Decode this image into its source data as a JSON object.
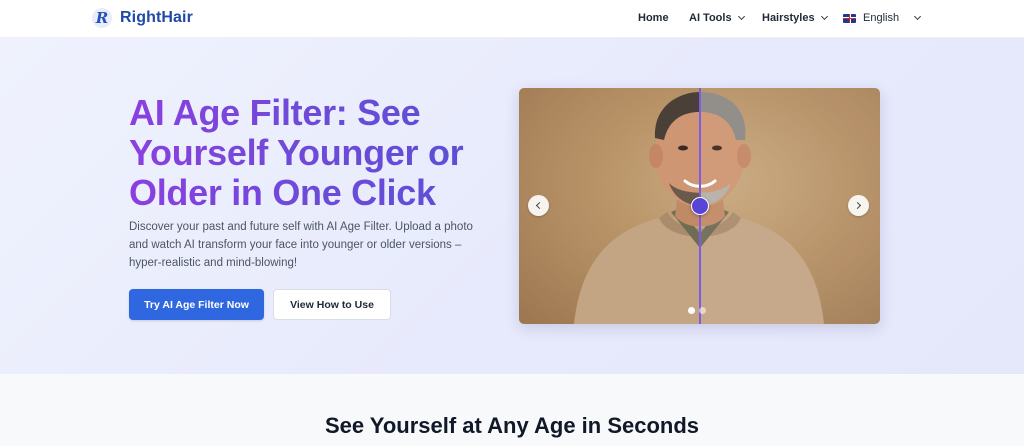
{
  "nav": {
    "brand_letter": "R",
    "brand_name": "RightHair",
    "links": [
      {
        "label": "Home",
        "has_dropdown": false
      },
      {
        "label": "AI Tools",
        "has_dropdown": true
      },
      {
        "label": "Hairstyles",
        "has_dropdown": true
      }
    ],
    "language": {
      "label": "English",
      "icon": "uk-flag-icon"
    }
  },
  "hero": {
    "title": "AI Age Filter: See Yourself Younger or Older in One Click",
    "description": "Discover your past and future self with AI Age Filter. Upload a photo and watch AI transform your face into younger or older versions – hyper-realistic and mind-blowing!",
    "primary_button": "Try AI Age Filter Now",
    "secondary_button": "View How to Use",
    "title_gradient": [
      "#8b3fe0",
      "#5850d6"
    ],
    "primary_color": "#2f67e0"
  },
  "slider": {
    "image_icon": "before-after-portrait",
    "divider_position": 0.5,
    "slide_count": 2,
    "active_slide": 1,
    "accent_color": "#5845d8"
  },
  "section": {
    "title": "See Yourself at Any Age in Seconds"
  }
}
